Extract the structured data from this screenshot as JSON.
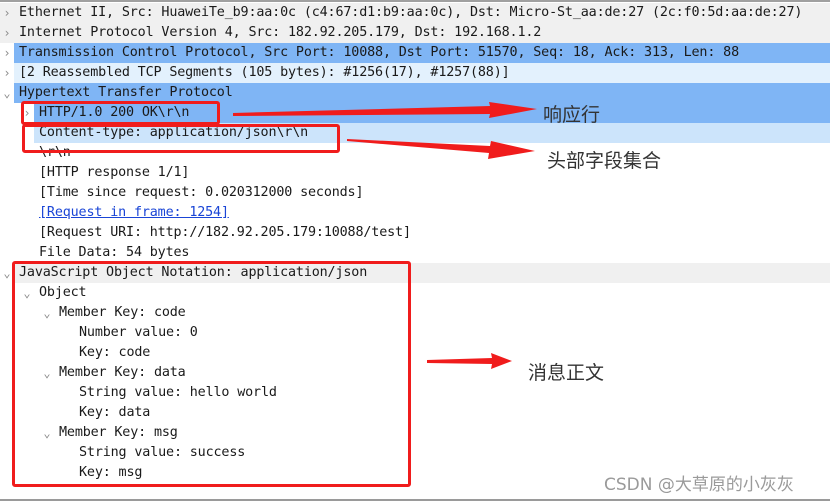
{
  "tree": {
    "rows": [
      {
        "toggle": ">",
        "text": "Ethernet II, Src: HuaweiTe_b9:aa:0c (c4:67:d1:b9:aa:0c), Dst: Micro-St_aa:de:27 (2c:f0:5d:aa:de:27)"
      },
      {
        "toggle": ">",
        "text": "Internet Protocol Version 4, Src: 182.92.205.179, Dst: 192.168.1.2"
      },
      {
        "toggle": ">",
        "text": "Transmission Control Protocol, Src Port: 10088, Dst Port: 51570, Seq: 18, Ack: 313, Len: 88"
      },
      {
        "toggle": ">",
        "text": "[2 Reassembled TCP Segments (105 bytes): #1256(17), #1257(88)]"
      },
      {
        "toggle": "v",
        "text": "Hypertext Transfer Protocol"
      },
      {
        "toggle": ">",
        "text": "HTTP/1.0 200 OK\\r\\n"
      },
      {
        "toggle": "",
        "text": "Content-type: application/json\\r\\n"
      },
      {
        "toggle": "",
        "text": "\\r\\n"
      },
      {
        "toggle": "",
        "text": "[HTTP response 1/1]"
      },
      {
        "toggle": "",
        "text": "[Time since request: 0.020312000 seconds]"
      },
      {
        "toggle": "",
        "text": "[Request in frame: 1254]"
      },
      {
        "toggle": "",
        "text": "[Request URI: http://182.92.205.179:10088/test]"
      },
      {
        "toggle": "",
        "text": "File Data: 54 bytes"
      },
      {
        "toggle": "v",
        "text": "JavaScript Object Notation: application/json"
      },
      {
        "toggle": "v",
        "text": "Object"
      },
      {
        "toggle": "v",
        "text": "Member Key: code"
      },
      {
        "toggle": "",
        "text": "Number value: 0"
      },
      {
        "toggle": "",
        "text": "Key: code"
      },
      {
        "toggle": "v",
        "text": "Member Key: data"
      },
      {
        "toggle": "",
        "text": "String value: hello world"
      },
      {
        "toggle": "",
        "text": "Key: data"
      },
      {
        "toggle": "v",
        "text": "Member Key: msg"
      },
      {
        "toggle": "",
        "text": "String value: success"
      },
      {
        "toggle": "",
        "text": "Key: msg"
      }
    ]
  },
  "annotations": {
    "status_line": "响应行",
    "headers": "头部字段集合",
    "body": "消息正文"
  },
  "watermark": "CSDN @大草原的小灰灰",
  "colors": {
    "selected_row": "#7fb5f5",
    "annotation_red": "#f01c1c",
    "link": "#1a45d6"
  }
}
